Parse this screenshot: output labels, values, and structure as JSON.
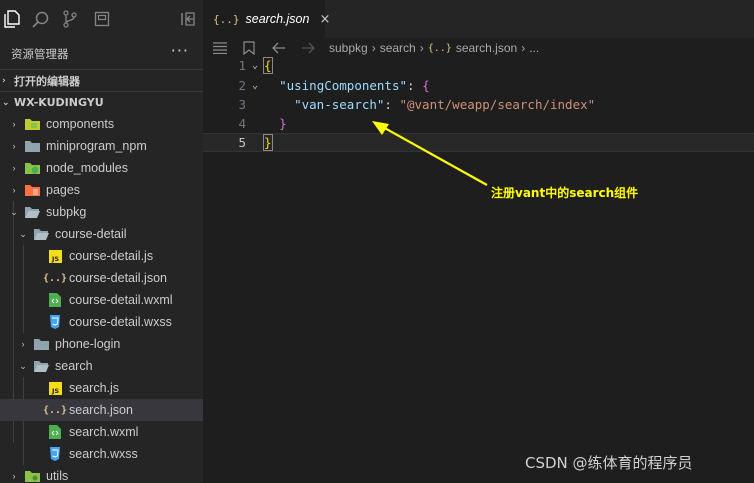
{
  "activity_bar": {
    "icons": [
      "files-icon",
      "search-icon",
      "source-control-icon",
      "extensions-icon",
      "toggle-panel-icon"
    ]
  },
  "explorer": {
    "title": "资源管理器",
    "more": "···",
    "open_editors_label": "打开的编辑器",
    "workspace_label": "WX-KUDINGYU",
    "tree": [
      {
        "label": "components",
        "kind": "folder-components",
        "depth": 1,
        "chevron": "›"
      },
      {
        "label": "miniprogram_npm",
        "kind": "folder",
        "depth": 1,
        "chevron": "›"
      },
      {
        "label": "node_modules",
        "kind": "folder-node",
        "depth": 1,
        "chevron": "›"
      },
      {
        "label": "pages",
        "kind": "folder-pages",
        "depth": 1,
        "chevron": "›"
      },
      {
        "label": "subpkg",
        "kind": "folder-open",
        "depth": 1,
        "chevron": "⌄"
      },
      {
        "label": "course-detail",
        "kind": "folder-open",
        "depth": 2,
        "chevron": "⌄"
      },
      {
        "label": "course-detail.js",
        "kind": "js",
        "depth": 3,
        "chevron": ""
      },
      {
        "label": "course-detail.json",
        "kind": "json",
        "depth": 3,
        "chevron": ""
      },
      {
        "label": "course-detail.wxml",
        "kind": "wxml",
        "depth": 3,
        "chevron": ""
      },
      {
        "label": "course-detail.wxss",
        "kind": "wxss",
        "depth": 3,
        "chevron": ""
      },
      {
        "label": "phone-login",
        "kind": "folder",
        "depth": 2,
        "chevron": "›"
      },
      {
        "label": "search",
        "kind": "folder-open",
        "depth": 2,
        "chevron": "⌄"
      },
      {
        "label": "search.js",
        "kind": "js",
        "depth": 3,
        "chevron": ""
      },
      {
        "label": "search.json",
        "kind": "json",
        "depth": 3,
        "chevron": "",
        "selected": true
      },
      {
        "label": "search.wxml",
        "kind": "wxml",
        "depth": 3,
        "chevron": ""
      },
      {
        "label": "search.wxss",
        "kind": "wxss",
        "depth": 3,
        "chevron": ""
      },
      {
        "label": "utils",
        "kind": "folder-utils",
        "depth": 1,
        "chevron": "›"
      }
    ]
  },
  "tab": {
    "icon": "{..}",
    "label": "search.json",
    "close": "×"
  },
  "breadcrumb": {
    "items": [
      "subpkg",
      "search",
      "search.json",
      "..."
    ],
    "json_icon": "{..}"
  },
  "code": {
    "lines": [
      {
        "num": "1",
        "fold": "⌄"
      },
      {
        "num": "2",
        "fold": "⌄"
      },
      {
        "num": "3",
        "fold": ""
      },
      {
        "num": "4",
        "fold": ""
      },
      {
        "num": "5",
        "fold": ""
      }
    ],
    "key_using": "\"usingComponents\"",
    "key_van": "\"van-search\"",
    "val_van": "\"@vant/weapp/search/index\""
  },
  "annotation": {
    "text": "注册vant中的search组件",
    "color": "#ffff00"
  },
  "watermark": "CSDN @练体育的程序员",
  "colors": {
    "sidebar_bg": "#252526",
    "editor_bg": "#1e1e1e",
    "selected_bg": "#37373d",
    "key": "#9cdcfe",
    "string": "#ce9178",
    "brace_gold": "#ffd700",
    "brace_purple": "#da70d6"
  }
}
